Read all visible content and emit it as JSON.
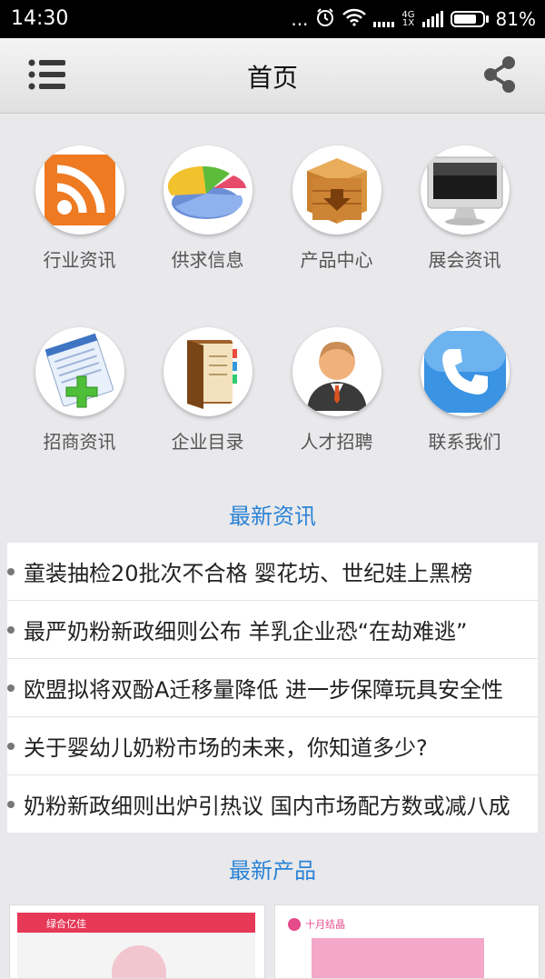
{
  "status_bar": {
    "time": "14:30",
    "dots": "...",
    "net_type_top": "4G",
    "net_type_bottom": "1X",
    "battery": "81%"
  },
  "app_bar": {
    "title": "首页"
  },
  "grid": [
    {
      "label": "行业资讯"
    },
    {
      "label": "供求信息"
    },
    {
      "label": "产品中心"
    },
    {
      "label": "展会资讯"
    },
    {
      "label": "招商资讯"
    },
    {
      "label": "企业目录"
    },
    {
      "label": "人才招聘"
    },
    {
      "label": "联系我们"
    }
  ],
  "news_section": {
    "title": "最新资讯",
    "items": [
      "童装抽检20批次不合格 婴花坊、世纪娃上黑榜",
      "最严奶粉新政细则公布 羊乳企业恐“在劫难逃”",
      "欧盟拟将双酚A迁移量降低 进一步保障玩具安全性",
      "关于婴幼儿奶粉市场的未来，你知道多少?",
      "奶粉新政细则出炉引热议 国内市场配方数或减八成"
    ]
  },
  "products_section": {
    "title": "最新产品",
    "items": [
      {
        "brand": "绿合亿佳"
      },
      {
        "brand": "十月结晶"
      }
    ]
  }
}
